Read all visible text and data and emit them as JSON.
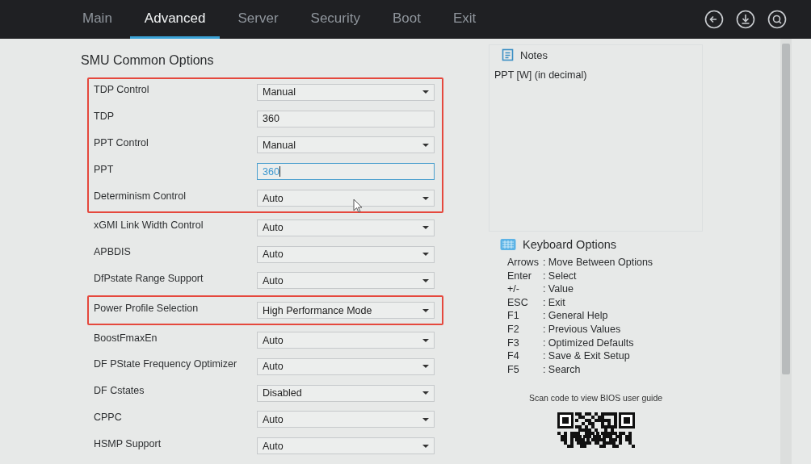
{
  "tabs": [
    {
      "label": "Main",
      "selected": false
    },
    {
      "label": "Advanced",
      "selected": true
    },
    {
      "label": "Server",
      "selected": false
    },
    {
      "label": "Security",
      "selected": false
    },
    {
      "label": "Boot",
      "selected": false
    },
    {
      "label": "Exit",
      "selected": false
    }
  ],
  "toolbar": [
    {
      "kind": "back"
    },
    {
      "kind": "save"
    },
    {
      "kind": "search"
    }
  ],
  "page_title": "SMU Common Options",
  "groups": [
    {
      "highlighted": true,
      "rows": [
        {
          "label": "TDP Control",
          "kind": "dropdown",
          "value": "Manual"
        },
        {
          "label": "TDP",
          "kind": "number",
          "value": "360",
          "focused": false
        },
        {
          "label": "PPT Control",
          "kind": "dropdown",
          "value": "Manual"
        },
        {
          "label": "PPT",
          "kind": "number",
          "value": "360",
          "focused": true
        },
        {
          "label": "Determinism Control",
          "kind": "dropdown",
          "value": "Auto"
        }
      ]
    },
    {
      "highlighted": false,
      "rows": [
        {
          "label": "xGMI Link Width Control",
          "kind": "dropdown",
          "value": "Auto"
        },
        {
          "label": "APBDIS",
          "kind": "dropdown",
          "value": "Auto"
        },
        {
          "label": "DfPstate Range Support",
          "kind": "dropdown",
          "value": "Auto"
        }
      ]
    },
    {
      "highlighted": true,
      "rows": [
        {
          "label": "Power Profile Selection",
          "kind": "dropdown",
          "value": "High Performance Mode"
        }
      ]
    },
    {
      "highlighted": false,
      "rows": [
        {
          "label": "BoostFmaxEn",
          "kind": "dropdown",
          "value": "Auto"
        },
        {
          "label": "DF PState Frequency Optimizer",
          "kind": "dropdown",
          "value": "Auto"
        },
        {
          "label": "DF Cstates",
          "kind": "dropdown",
          "value": "Disabled"
        },
        {
          "label": "CPPC",
          "kind": "dropdown",
          "value": "Auto"
        },
        {
          "label": "HSMP Support",
          "kind": "dropdown",
          "value": "Auto"
        }
      ]
    }
  ],
  "notes": {
    "title": "Notes",
    "text": "PPT [W] (in decimal)"
  },
  "keyboard": {
    "title": "Keyboard Options",
    "keys": [
      {
        "key": "Arrows",
        "action": ": Move Between Options"
      },
      {
        "key": "Enter",
        "action": ": Select"
      },
      {
        "key": "+/-",
        "action": ": Value"
      },
      {
        "key": "ESC",
        "action": ": Exit"
      },
      {
        "key": "F1",
        "action": ": General Help"
      },
      {
        "key": "F2",
        "action": ": Previous Values"
      },
      {
        "key": "F3",
        "action": ": Optimized Defaults"
      },
      {
        "key": "F4",
        "action": ": Save & Exit Setup"
      },
      {
        "key": "F5",
        "action": ": Search"
      }
    ]
  },
  "guide_text": "Scan code to view BIOS user guide"
}
